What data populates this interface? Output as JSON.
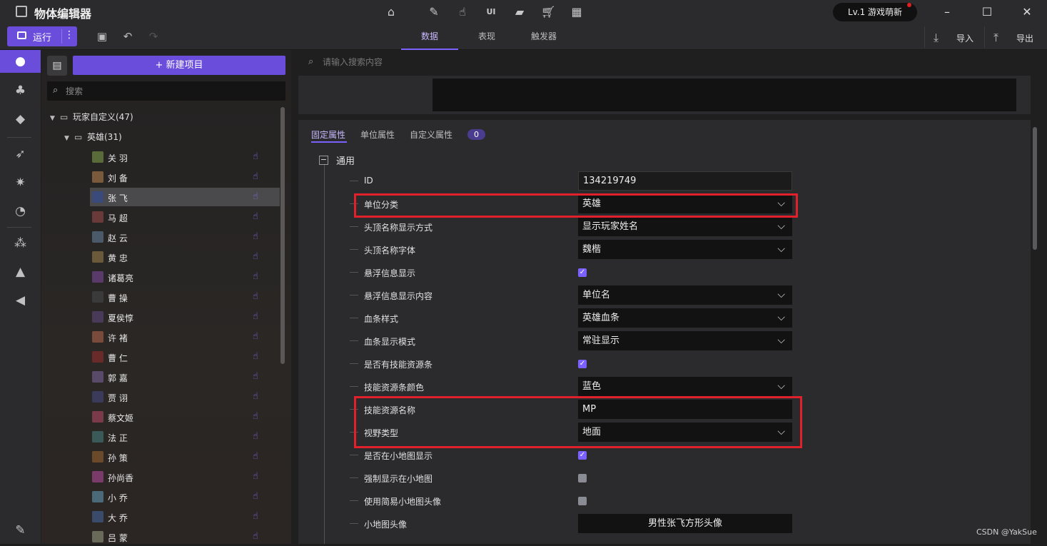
{
  "window": {
    "title": "物体编辑器",
    "user_level": "Lv.1 游戏萌新",
    "top_icons": [
      "home-icon",
      "brush-icon",
      "hand-icon",
      "ui-icon",
      "folder-icon",
      "cart-icon",
      "grid-icon"
    ],
    "controls": [
      "minimize-icon",
      "maximize-icon",
      "close-icon"
    ]
  },
  "toolbar": {
    "run_label": "运行",
    "tabs": [
      {
        "label": "数据",
        "active": true
      },
      {
        "label": "表现",
        "active": false
      },
      {
        "label": "触发器",
        "active": false
      }
    ],
    "import_label": "导入",
    "export_label": "导出"
  },
  "rail": {
    "items": [
      "person-icon",
      "tree-icon",
      "cube-icon",
      "bow-icon",
      "sparkle-icon",
      "swirl-icon",
      "nodes-icon",
      "hat-icon",
      "speaker-icon",
      "edit-icon"
    ]
  },
  "tree": {
    "new_item_label": "+ 新建项目",
    "search_placeholder": "搜索",
    "root_folder": "玩家自定义(47)",
    "sub_folder": "英雄(31)",
    "heroes": [
      "关 羽",
      "刘 备",
      "张 飞",
      "马 超",
      "赵 云",
      "黄 忠",
      "诸葛亮",
      "曹 操",
      "夏侯惇",
      "许 褚",
      "曹 仁",
      "郭 嘉",
      "贾 诩",
      "蔡文姬",
      "法 正",
      "孙 策",
      "孙尚香",
      "小 乔",
      "大 乔",
      "吕 蒙"
    ],
    "selected_index": 2
  },
  "main": {
    "search_placeholder": "请输入搜索内容",
    "prop_tabs": [
      {
        "label": "固定属性",
        "active": true
      },
      {
        "label": "单位属性",
        "active": false
      },
      {
        "label": "自定义属性",
        "active": false
      }
    ],
    "custom_count": "0",
    "group_label": "通用",
    "group_toggle": "−",
    "properties": [
      {
        "label": "ID",
        "kind": "input",
        "value": "134219749"
      },
      {
        "label": "单位分类",
        "kind": "select",
        "value": "英雄"
      },
      {
        "label": "头顶名称显示方式",
        "kind": "select",
        "value": "显示玩家姓名"
      },
      {
        "label": "头顶名称字体",
        "kind": "select",
        "value": "魏楷"
      },
      {
        "label": "悬浮信息显示",
        "kind": "checkbox",
        "checked": true
      },
      {
        "label": "悬浮信息显示内容",
        "kind": "select",
        "value": "单位名"
      },
      {
        "label": "血条样式",
        "kind": "select",
        "value": "英雄血条"
      },
      {
        "label": "血条显示模式",
        "kind": "select",
        "value": "常驻显示"
      },
      {
        "label": "是否有技能资源条",
        "kind": "checkbox",
        "checked": true
      },
      {
        "label": "技能资源条颜色",
        "kind": "select",
        "value": "蓝色"
      },
      {
        "label": "技能资源名称",
        "kind": "text",
        "value": " MP"
      },
      {
        "label": "视野类型",
        "kind": "select",
        "value": "地面"
      },
      {
        "label": "是否在小地图显示",
        "kind": "checkbox",
        "checked": true
      },
      {
        "label": "强制显示在小地图",
        "kind": "checkbox",
        "checked": false
      },
      {
        "label": "使用简易小地图头像",
        "kind": "checkbox",
        "checked": false
      },
      {
        "label": "小地图头像",
        "kind": "button",
        "value": "男性张飞方形头像"
      }
    ]
  },
  "watermark": "CSDN @YakSue",
  "colors": {
    "accent": "#6a4ddb",
    "highlight_box": "#e0202a",
    "background": "#1e1e1f"
  }
}
